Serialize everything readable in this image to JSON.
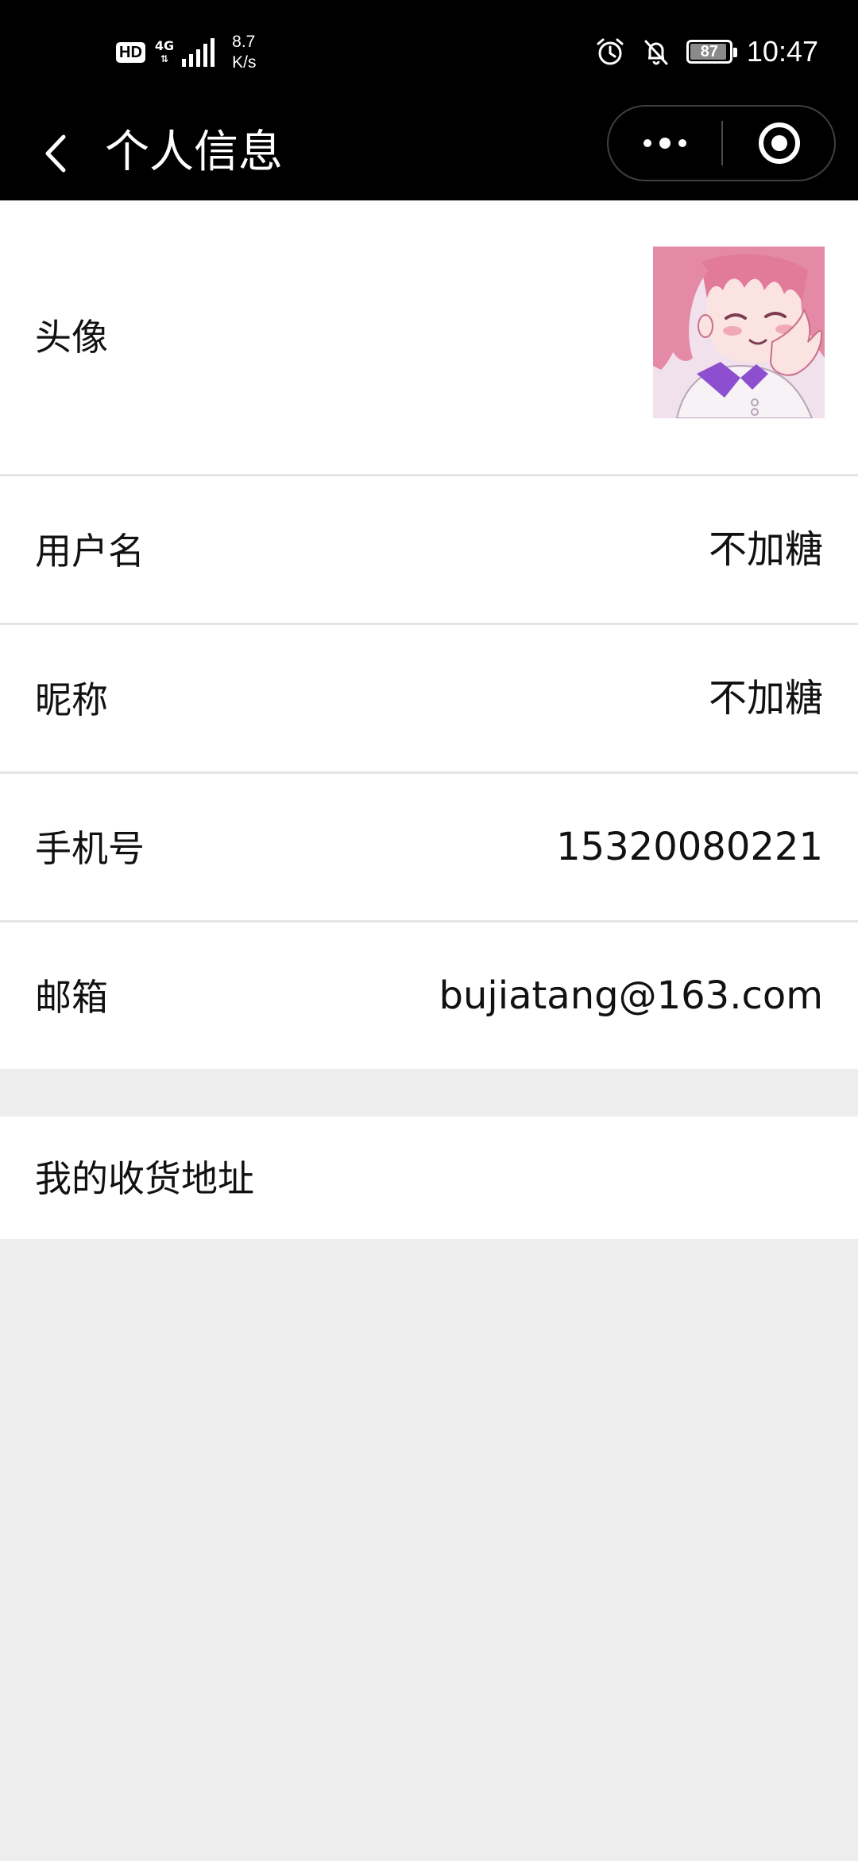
{
  "status_bar": {
    "hd": "HD",
    "network": "4G",
    "speed_value": "8.7",
    "speed_unit": "K/s",
    "battery": "87",
    "time": "10:47"
  },
  "nav": {
    "title": "个人信息"
  },
  "profile": {
    "avatar_label": "头像",
    "username_label": "用户名",
    "username_value": "不加糖",
    "nickname_label": "昵称",
    "nickname_value": "不加糖",
    "phone_label": "手机号",
    "phone_value": "15320080221",
    "email_label": "邮箱",
    "email_value": "bujiatang@163.com"
  },
  "address": {
    "label": "我的收货地址"
  },
  "colors": {
    "background": "#ededed",
    "bar": "#000000",
    "card": "#ffffff"
  }
}
